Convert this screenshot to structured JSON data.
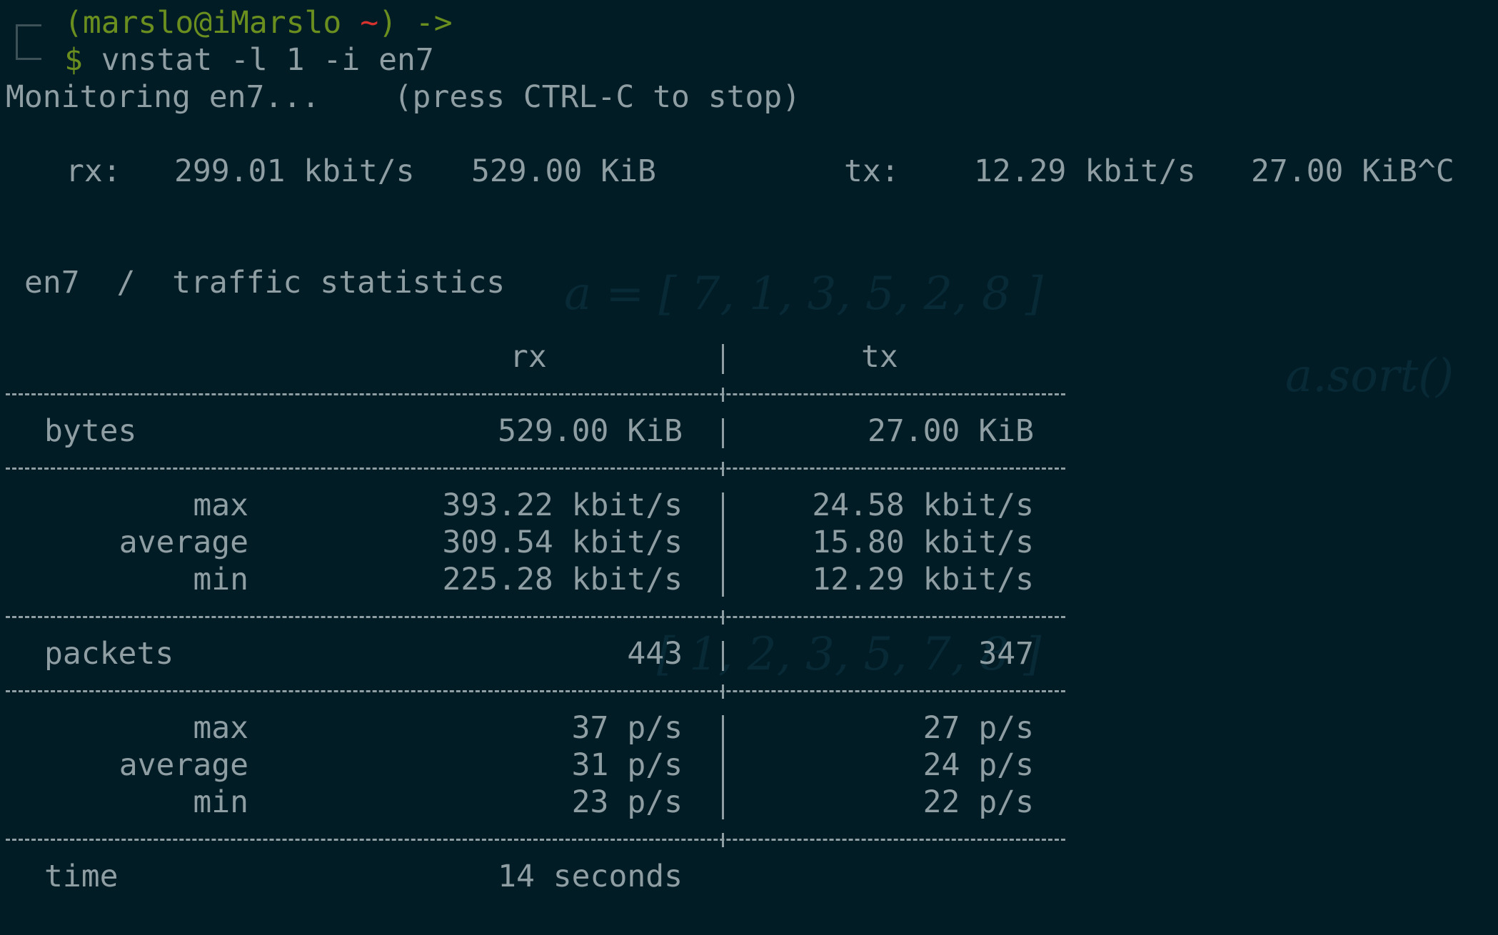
{
  "prompt": {
    "user_host": "(marslo@iMarslo",
    "tilde": "~",
    "close": ")",
    "arrow": "->",
    "dollar": "$",
    "command": "vnstat -l 1 -i en7"
  },
  "monitoring": {
    "text": "Monitoring en7...",
    "hint": "(press CTRL-C to stop)"
  },
  "live": {
    "rx_label": "rx:",
    "rx_rate": "299.01 kbit/s",
    "rx_total": "529.00 KiB",
    "tx_label": "tx:",
    "tx_rate": "12.29 kbit/s",
    "tx_total": "27.00 KiB^C"
  },
  "stats": {
    "title": "en7  /  traffic statistics",
    "col_rx": "rx",
    "col_tx": "tx",
    "bytes": {
      "label": "bytes",
      "rx": "529.00 KiB",
      "tx": "27.00 KiB"
    },
    "rate": {
      "max": {
        "label": "max",
        "rx": "393.22 kbit/s",
        "tx": "24.58 kbit/s"
      },
      "average": {
        "label": "average",
        "rx": "309.54 kbit/s",
        "tx": "15.80 kbit/s"
      },
      "min": {
        "label": "min",
        "rx": "225.28 kbit/s",
        "tx": "12.29 kbit/s"
      }
    },
    "packets": {
      "label": "packets",
      "rx": "443",
      "tx": "347"
    },
    "pps": {
      "max": {
        "label": "max",
        "rx": "37 p/s",
        "tx": "27 p/s"
      },
      "average": {
        "label": "average",
        "rx": "31 p/s",
        "tx": "24 p/s"
      },
      "min": {
        "label": "min",
        "rx": "23 p/s",
        "tx": "22 p/s"
      }
    },
    "time": {
      "label": "time",
      "value": "14 seconds"
    }
  }
}
